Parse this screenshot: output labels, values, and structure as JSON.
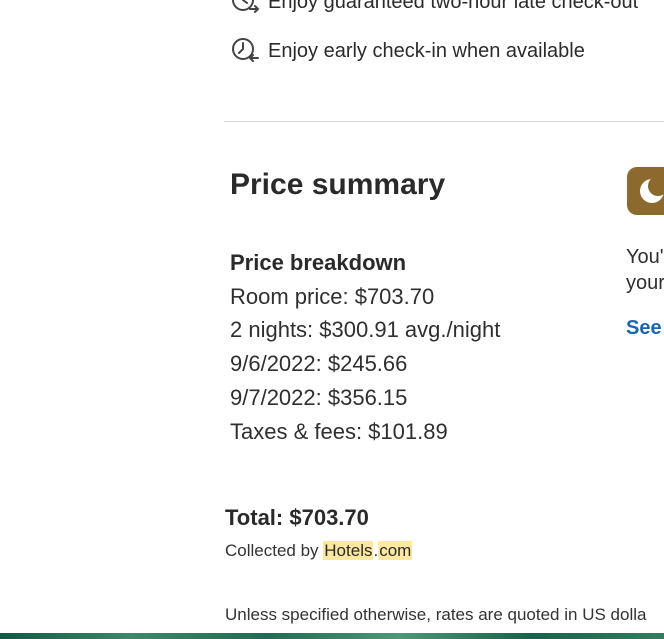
{
  "benefits": [
    {
      "icon": "late-checkout-icon",
      "text": "Enjoy guaranteed two-hour late check-out"
    },
    {
      "icon": "early-checkin-icon",
      "text": "Enjoy early check-in when available"
    }
  ],
  "price_summary": {
    "title": "Price summary",
    "breakdown_title": "Price breakdown",
    "items": [
      "Room price: $703.70",
      "2 nights: $300.91 avg./night",
      "9/6/2022: $245.66",
      "9/7/2022: $356.15",
      "Taxes & fees: $101.89"
    ],
    "total": "Total: $703.70",
    "collected_prefix": "Collected by ",
    "collected_brand_part1": "Hotels",
    "collected_brand_dot": ".",
    "collected_brand_part2": "com",
    "footnote": "Unless specified otherwise, rates are quoted in US dolla"
  },
  "side_panel": {
    "badge_icon": "moon-icon",
    "badge_color": "#8c6a2e",
    "line1": "You'",
    "line2": "your",
    "link": "See"
  },
  "colors": {
    "link": "#1a66b5",
    "highlight": "#fde8a0"
  }
}
